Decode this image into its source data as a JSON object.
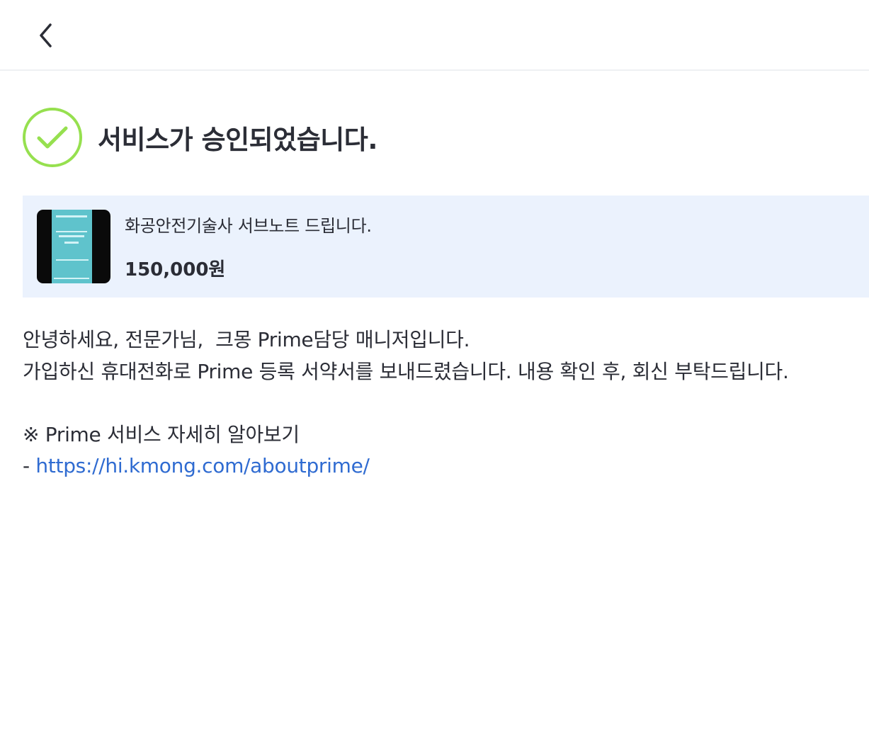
{
  "header": {
    "back_icon": "chevron-left-icon"
  },
  "status": {
    "icon": "check-circle-icon",
    "icon_color": "#96e04f",
    "title": "서비스가 승인되었습니다."
  },
  "service": {
    "thumbnail_icon": "book-cover-thumbnail",
    "title": "화공안전기술사 서브노트 드립니다.",
    "price": "150,000원"
  },
  "message": {
    "line1": "안녕하세요, 전문가님,  크몽 Prime담당 매니저입니다.",
    "line2": "가입하신 휴대전화로 Prime 등록 서약서를 보내드렸습니다. 내용 확인 후, 회신 부탁드립니다.",
    "line3": "※ Prime 서비스 자세히 알아보기",
    "link_prefix": "- ",
    "link_text": "https://hi.kmong.com/aboutprime/",
    "link_color": "#2f6bd1"
  }
}
